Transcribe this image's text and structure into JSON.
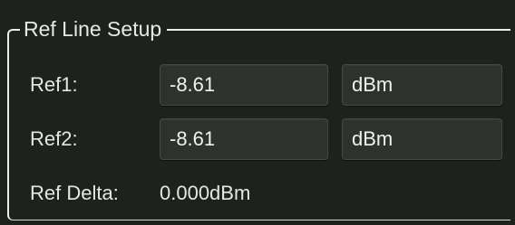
{
  "group": {
    "title": "Ref Line Setup"
  },
  "ref1": {
    "label": "Ref1:",
    "value": "-8.61",
    "unit": "dBm"
  },
  "ref2": {
    "label": "Ref2:",
    "value": "-8.61",
    "unit": "dBm"
  },
  "delta": {
    "label": "Ref Delta:",
    "value": "0.000dBm"
  }
}
